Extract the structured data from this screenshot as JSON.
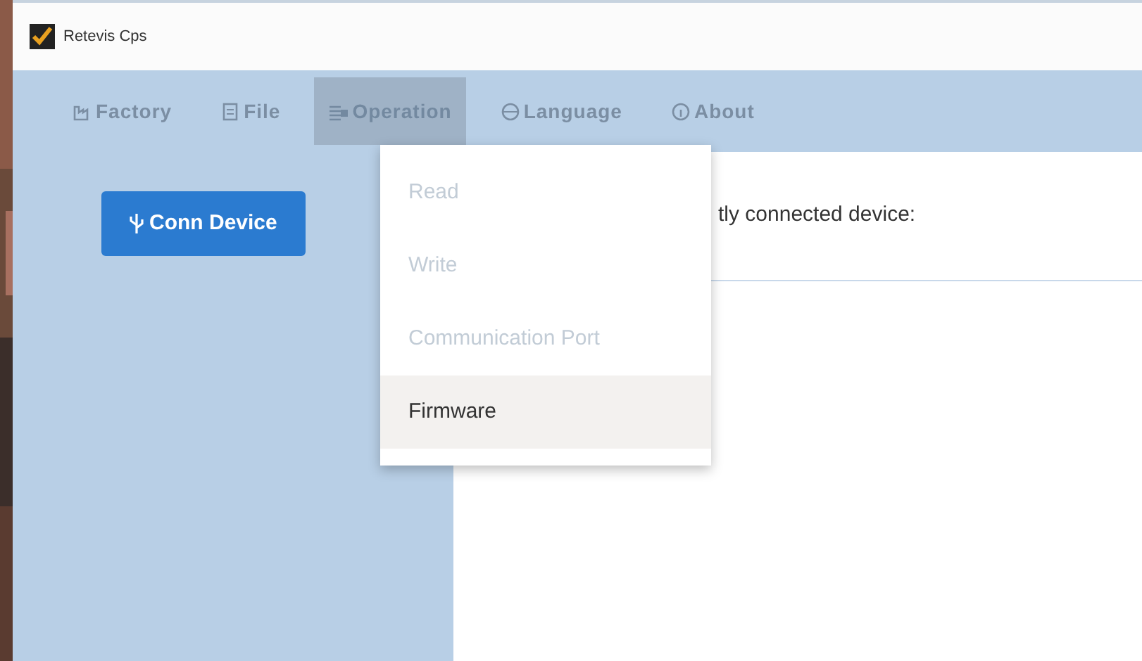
{
  "window": {
    "title": "Retevis Cps"
  },
  "menu_bar": [
    {
      "label": "Factory",
      "selected": false
    },
    {
      "label": "File",
      "selected": false
    },
    {
      "label": "Operation",
      "selected": true
    },
    {
      "label": "Language",
      "selected": false
    },
    {
      "label": "About",
      "selected": false
    }
  ],
  "dropdown": [
    {
      "label": "Read",
      "disabled": true,
      "selected": false
    },
    {
      "label": "Write",
      "disabled": true,
      "selected": false
    },
    {
      "label": "Communication Port",
      "disabled": true,
      "selected": false
    },
    {
      "label": "Firmware",
      "disabled": false,
      "selected": true
    }
  ],
  "sidebar": {
    "button": "Conn Device"
  },
  "content": {
    "status_label": "tly connected device:"
  }
}
